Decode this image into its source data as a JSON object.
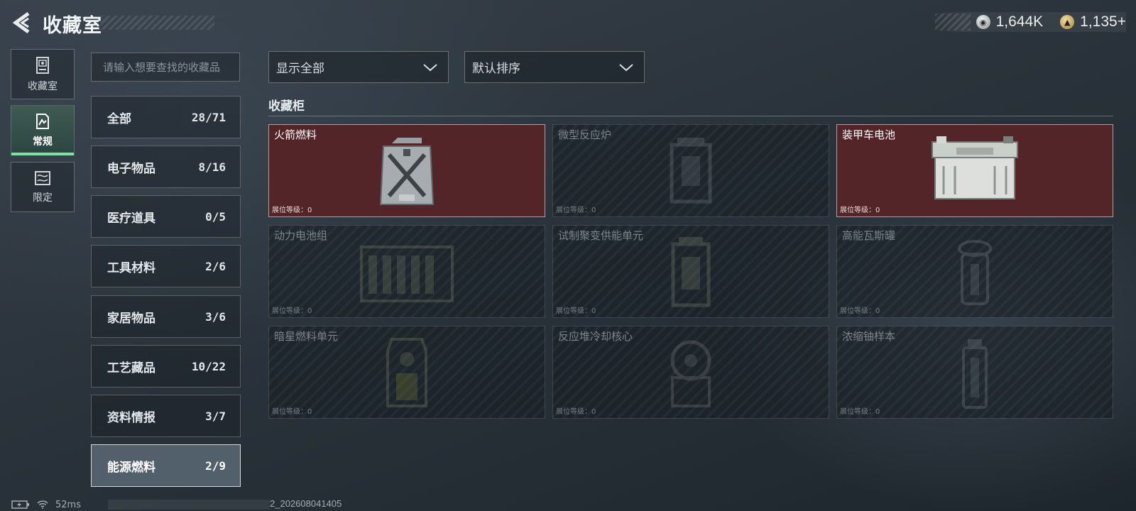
{
  "header": {
    "title": "收藏室",
    "currencies": [
      {
        "icon": "silver-coin-icon",
        "value": "1,644K"
      },
      {
        "icon": "gold-coin-icon",
        "value": "1,135+"
      }
    ]
  },
  "side_nav": [
    {
      "label": "收藏室",
      "icon": "collection-room-icon",
      "active": false
    },
    {
      "label": "常规",
      "icon": "regular-icon",
      "active": true
    },
    {
      "label": "限定",
      "icon": "limited-icon",
      "active": false
    }
  ],
  "search": {
    "placeholder": "请输入想要查找的收藏品",
    "value": ""
  },
  "categories": [
    {
      "name": "全部",
      "count": "28/71"
    },
    {
      "name": "电子物品",
      "count": "8/16"
    },
    {
      "name": "医疗道具",
      "count": "0/5"
    },
    {
      "name": "工具材料",
      "count": "2/6"
    },
    {
      "name": "家居物品",
      "count": "3/6"
    },
    {
      "name": "工艺藏品",
      "count": "10/22"
    },
    {
      "name": "资料情报",
      "count": "3/7"
    },
    {
      "name": "能源燃料",
      "count": "2/9",
      "active": true
    }
  ],
  "filters": {
    "show": "显示全部",
    "sort": "默认排序"
  },
  "section": {
    "title": "收藏柜"
  },
  "level_label": "展位等级：",
  "items": [
    {
      "name": "火箭燃料",
      "level": "0",
      "owned": true
    },
    {
      "name": "微型反应炉",
      "level": "0",
      "owned": false
    },
    {
      "name": "装甲车电池",
      "level": "0",
      "owned": true
    },
    {
      "name": "动力电池组",
      "level": "0",
      "owned": false
    },
    {
      "name": "试制聚变供能单元",
      "level": "0",
      "owned": false
    },
    {
      "name": "高能瓦斯罐",
      "level": "0",
      "owned": false
    },
    {
      "name": "暗星燃料单元",
      "level": "0",
      "owned": false
    },
    {
      "name": "反应堆冷却核心",
      "level": "0",
      "owned": false
    },
    {
      "name": "浓缩铀样本",
      "level": "0",
      "owned": false
    }
  ],
  "footer": {
    "ping": "52ms",
    "build": "2_202608041405"
  },
  "colors": {
    "owned_bg": "#542528",
    "active_tab_accent": "#7fe0a6",
    "active_category_bg": "#5a6874"
  }
}
